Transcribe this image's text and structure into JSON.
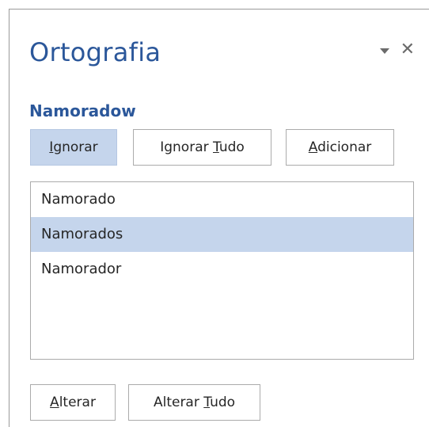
{
  "pane": {
    "title": "Ortografia",
    "misspelled_word": "Namoradow"
  },
  "buttons": {
    "ignore": {
      "before": "",
      "accel": "I",
      "after": "gnorar"
    },
    "ignore_all": {
      "before": "Ignorar ",
      "accel": "T",
      "after": "udo"
    },
    "add": {
      "before": "",
      "accel": "A",
      "after": "dicionar"
    },
    "change": {
      "before": "",
      "accel": "A",
      "after": "lterar"
    },
    "change_all": {
      "before": "Alterar ",
      "accel": "T",
      "after": "udo"
    }
  },
  "suggestions": [
    "Namorado",
    "Namorados",
    "Namorador"
  ],
  "selected_suggestion": "Namorados",
  "colors": {
    "accent": "#2b579a",
    "selection": "#c5d5ec"
  },
  "icons": {
    "menu": "chevron-down-icon",
    "close": "close-icon"
  }
}
